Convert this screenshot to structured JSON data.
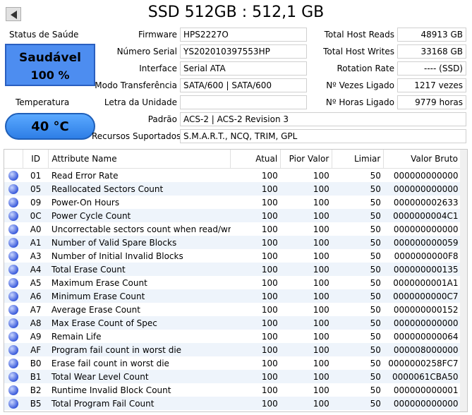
{
  "title": "SSD 512GB : 512,1 GB",
  "health": {
    "label": "Status de Saúde",
    "status": "Saudável",
    "percent": "100 %",
    "color": "#4d8df0"
  },
  "temperature": {
    "label": "Temperatura",
    "value": "40 °C"
  },
  "info_left": [
    {
      "label": "Firmware",
      "value": "HPS2227O"
    },
    {
      "label": "Número Serial",
      "value": "YS202010397553HP"
    },
    {
      "label": "Interface",
      "value": "Serial ATA"
    },
    {
      "label": "Modo Transferência",
      "value": "SATA/600 | SATA/600"
    },
    {
      "label": "Letra da Unidade",
      "value": ""
    }
  ],
  "info_right": [
    {
      "label": "Total Host Reads",
      "value": "48913 GB"
    },
    {
      "label": "Total Host Writes",
      "value": "33168 GB"
    },
    {
      "label": "Rotation Rate",
      "value": "---- (SSD)"
    },
    {
      "label": "Nº Vezes Ligado",
      "value": "1217 vezes"
    },
    {
      "label": "Nº Horas Ligado",
      "value": "9779 horas"
    }
  ],
  "standard": {
    "label": "Padrão",
    "value": "ACS-2 | ACS-2 Revision 3"
  },
  "features": {
    "label": "Recursos Suportados",
    "value": "S.M.A.R.T., NCQ, TRIM, GPL"
  },
  "table": {
    "headers": [
      "",
      "ID",
      "Attribute Name",
      "Atual",
      "Pior Valor",
      "Limiar",
      "Valor Bruto"
    ],
    "rows": [
      [
        "01",
        "Read Error Rate",
        "100",
        "100",
        "50",
        "000000000000"
      ],
      [
        "05",
        "Reallocated Sectors Count",
        "100",
        "100",
        "50",
        "000000000000"
      ],
      [
        "09",
        "Power-On Hours",
        "100",
        "100",
        "50",
        "000000002633"
      ],
      [
        "0C",
        "Power Cycle Count",
        "100",
        "100",
        "50",
        "0000000004C1"
      ],
      [
        "A0",
        "Uncorrectable sectors count when read/write",
        "100",
        "100",
        "50",
        "000000000000"
      ],
      [
        "A1",
        "Number of Valid Spare Blocks",
        "100",
        "100",
        "50",
        "000000000059"
      ],
      [
        "A3",
        "Number of Initial Invalid Blocks",
        "100",
        "100",
        "50",
        "0000000000F8"
      ],
      [
        "A4",
        "Total Erase Count",
        "100",
        "100",
        "50",
        "000000000135"
      ],
      [
        "A5",
        "Maximum Erase Count",
        "100",
        "100",
        "50",
        "0000000001A1"
      ],
      [
        "A6",
        "Minimum Erase Count",
        "100",
        "100",
        "50",
        "0000000000C7"
      ],
      [
        "A7",
        "Average Erase Count",
        "100",
        "100",
        "50",
        "000000000152"
      ],
      [
        "A8",
        "Max Erase Count of Spec",
        "100",
        "100",
        "50",
        "000000000000"
      ],
      [
        "A9",
        "Remain Life",
        "100",
        "100",
        "50",
        "000000000064"
      ],
      [
        "AF",
        "Program fail count in worst die",
        "100",
        "100",
        "50",
        "000008000000"
      ],
      [
        "B0",
        "Erase fail count in worst die",
        "100",
        "100",
        "50",
        "0000000258FC7"
      ],
      [
        "B1",
        "Total Wear Level Count",
        "100",
        "100",
        "50",
        "0000061CBA50"
      ],
      [
        "B2",
        "Runtime Invalid Block Count",
        "100",
        "100",
        "50",
        "000000000001"
      ],
      [
        "B5",
        "Total Program Fail Count",
        "100",
        "100",
        "50",
        "000000000000"
      ]
    ]
  }
}
